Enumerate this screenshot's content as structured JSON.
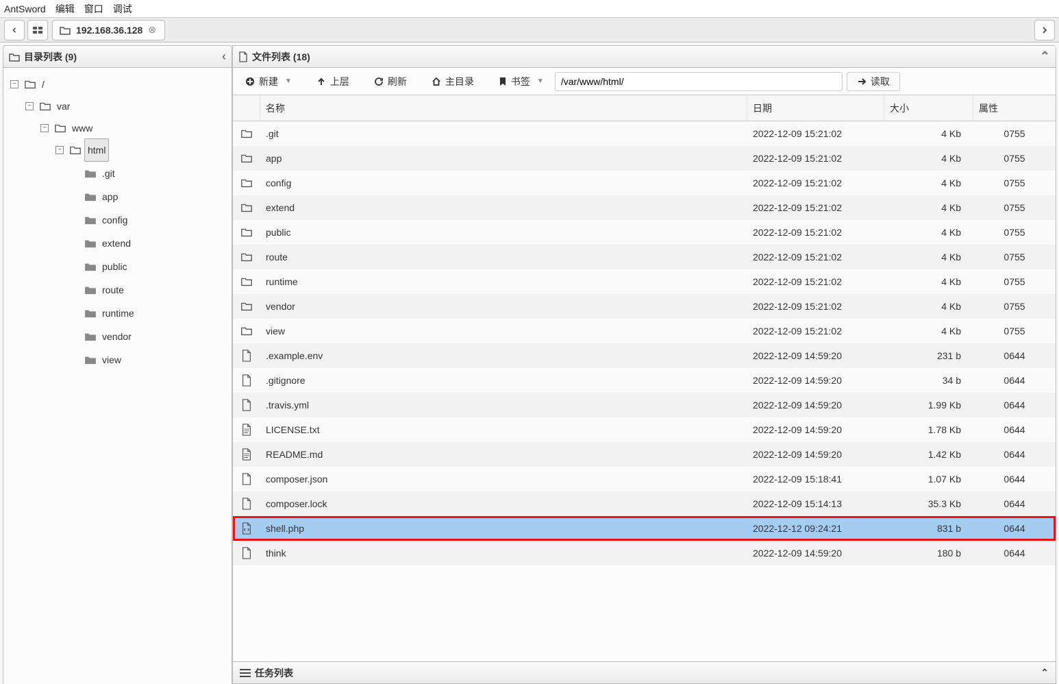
{
  "menu": {
    "app": "AntSword",
    "edit": "编辑",
    "window": "窗口",
    "debug": "调试"
  },
  "tabs": {
    "ip_label": "192.168.36.128"
  },
  "sidebar": {
    "title": "目录列表 (9)",
    "tree": {
      "root": {
        "label": "/",
        "toggle": "−"
      },
      "var": {
        "label": "var",
        "toggle": "−"
      },
      "www": {
        "label": "www",
        "toggle": "−"
      },
      "html": {
        "label": "html",
        "toggle": "−",
        "selected": true
      },
      "children": [
        {
          "label": ".git"
        },
        {
          "label": "app"
        },
        {
          "label": "config"
        },
        {
          "label": "extend"
        },
        {
          "label": "public"
        },
        {
          "label": "route"
        },
        {
          "label": "runtime"
        },
        {
          "label": "vendor"
        },
        {
          "label": "view"
        }
      ]
    }
  },
  "main": {
    "header_title": "文件列表 (18)",
    "toolbar": {
      "new": "新建",
      "up": "上层",
      "refresh": "刷新",
      "home": "主目录",
      "bookmark": "书签",
      "path": "/var/www/html/",
      "read": "读取"
    },
    "columns": {
      "name": "名称",
      "date": "日期",
      "size": "大小",
      "perm": "属性"
    },
    "rows": [
      {
        "icon": "folder",
        "name": ".git",
        "date": "2022-12-09 15:21:02",
        "size": "4 Kb",
        "perm": "0755"
      },
      {
        "icon": "folder",
        "name": "app",
        "date": "2022-12-09 15:21:02",
        "size": "4 Kb",
        "perm": "0755"
      },
      {
        "icon": "folder",
        "name": "config",
        "date": "2022-12-09 15:21:02",
        "size": "4 Kb",
        "perm": "0755"
      },
      {
        "icon": "folder",
        "name": "extend",
        "date": "2022-12-09 15:21:02",
        "size": "4 Kb",
        "perm": "0755"
      },
      {
        "icon": "folder",
        "name": "public",
        "date": "2022-12-09 15:21:02",
        "size": "4 Kb",
        "perm": "0755"
      },
      {
        "icon": "folder",
        "name": "route",
        "date": "2022-12-09 15:21:02",
        "size": "4 Kb",
        "perm": "0755"
      },
      {
        "icon": "folder",
        "name": "runtime",
        "date": "2022-12-09 15:21:02",
        "size": "4 Kb",
        "perm": "0755"
      },
      {
        "icon": "folder",
        "name": "vendor",
        "date": "2022-12-09 15:21:02",
        "size": "4 Kb",
        "perm": "0755"
      },
      {
        "icon": "folder",
        "name": "view",
        "date": "2022-12-09 15:21:02",
        "size": "4 Kb",
        "perm": "0755"
      },
      {
        "icon": "file",
        "name": ".example.env",
        "date": "2022-12-09 14:59:20",
        "size": "231 b",
        "perm": "0644"
      },
      {
        "icon": "file",
        "name": ".gitignore",
        "date": "2022-12-09 14:59:20",
        "size": "34 b",
        "perm": "0644"
      },
      {
        "icon": "file",
        "name": ".travis.yml",
        "date": "2022-12-09 14:59:20",
        "size": "1.99 Kb",
        "perm": "0644"
      },
      {
        "icon": "text",
        "name": "LICENSE.txt",
        "date": "2022-12-09 14:59:20",
        "size": "1.78 Kb",
        "perm": "0644"
      },
      {
        "icon": "text",
        "name": "README.md",
        "date": "2022-12-09 14:59:20",
        "size": "1.42 Kb",
        "perm": "0644"
      },
      {
        "icon": "file",
        "name": "composer.json",
        "date": "2022-12-09 15:18:41",
        "size": "1.07 Kb",
        "perm": "0644"
      },
      {
        "icon": "file",
        "name": "composer.lock",
        "date": "2022-12-09 15:14:13",
        "size": "35.3 Kb",
        "perm": "0644"
      },
      {
        "icon": "code",
        "name": "shell.php",
        "date": "2022-12-12 09:24:21",
        "size": "831 b",
        "perm": "0644",
        "selected": true,
        "highlight": true
      },
      {
        "icon": "file",
        "name": "think",
        "date": "2022-12-09 14:59:20",
        "size": "180 b",
        "perm": "0644"
      }
    ]
  },
  "footer": {
    "title": "任务列表"
  }
}
